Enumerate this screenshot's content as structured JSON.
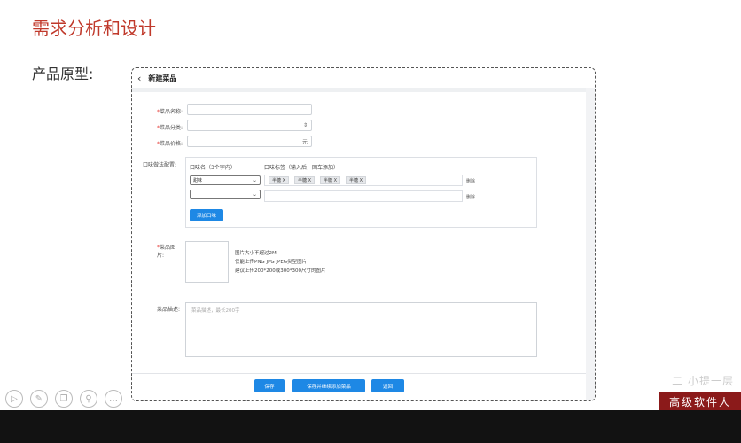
{
  "slide": {
    "title": "需求分析和设计",
    "subtitle": "产品原型:"
  },
  "prototype": {
    "header": {
      "back_icon": "chevron-left-icon",
      "title": "新建菜品"
    },
    "form": {
      "name_label": "菜品名称:",
      "category_label": "菜品分类:",
      "category_arrow": "⇕",
      "price_label": "菜品价格:",
      "price_unit": "元",
      "flavor_label": "口味做法配置:",
      "flavor_col_name": "口味名（3个字内）",
      "flavor_col_tags": "口味标签（输入后，回车添加）",
      "flavor_rows": [
        {
          "select": "甜味",
          "tags": [
            "半糖 X",
            "半糖 X",
            "半糖 X",
            "半糖 X"
          ],
          "delete": "删除"
        },
        {
          "select": "",
          "tags": [],
          "delete": "删除"
        }
      ],
      "add_flavor_button": "添加口味",
      "image_label": "菜品图片:",
      "image_notes": [
        "图片大小不超过2M",
        "仅能上传PNG JPG JPEG类型图片",
        "建议上传200*200或300*300尺寸的图片"
      ],
      "desc_label": "菜品描述:",
      "desc_placeholder": "菜品描述，最长200字"
    },
    "buttons": {
      "save": "保存",
      "save_continue": "保存并继续添加菜品",
      "back": "返回"
    }
  },
  "player_toolbar": [
    "play-icon",
    "edit-icon",
    "copy-icon",
    "zoom-icon",
    "more-icon"
  ],
  "brand": {
    "text": "高级软件人",
    "ghost": "二 小提一层"
  },
  "colors": {
    "title_red": "#c0392b",
    "primary_blue": "#1e88e5",
    "brand_red": "#8b1a1a"
  }
}
